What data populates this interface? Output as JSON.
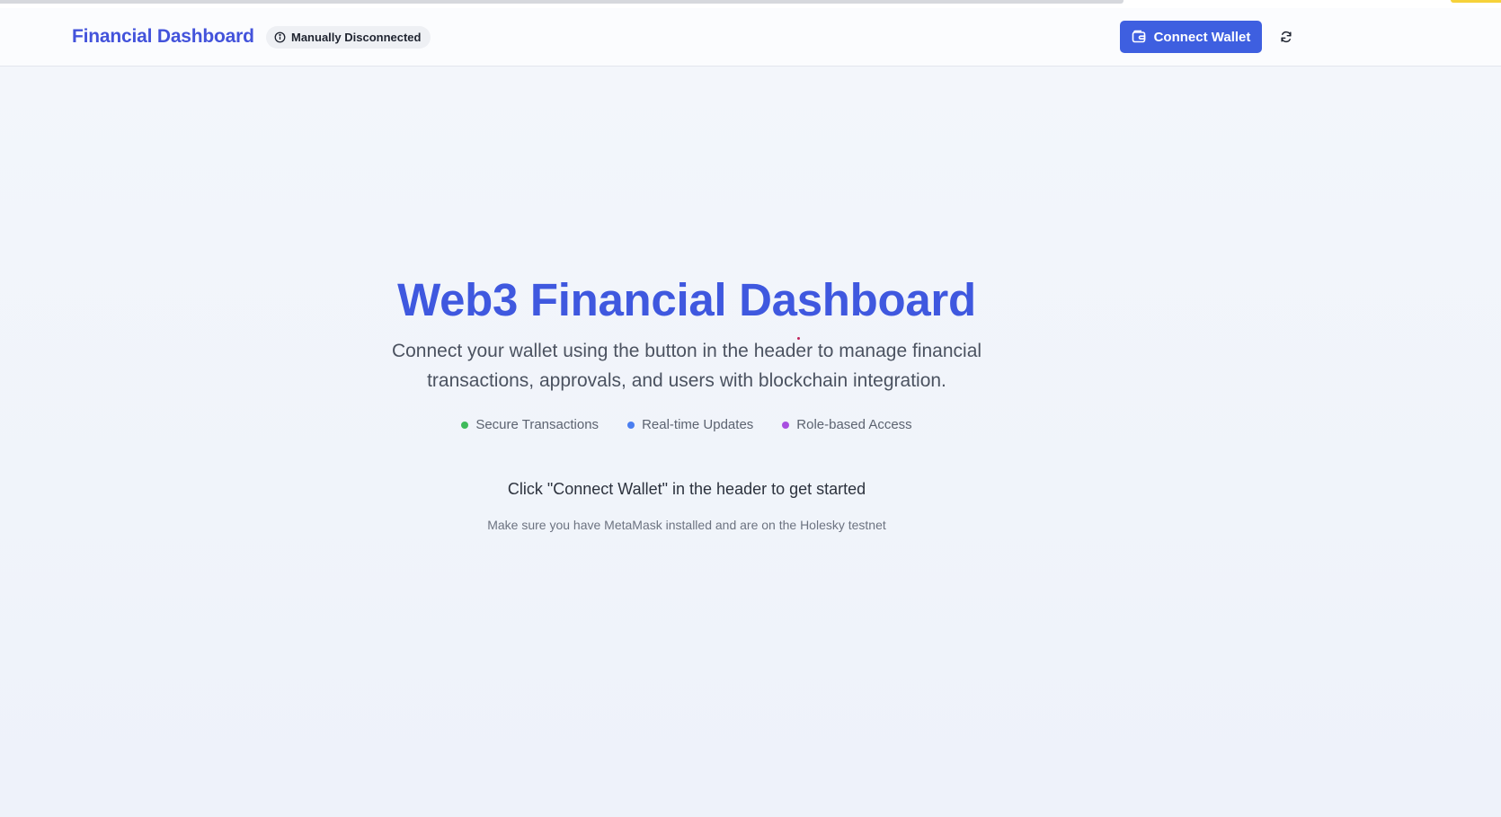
{
  "header": {
    "brand": "Financial Dashboard",
    "status_badge": {
      "label": "Manually Disconnected",
      "icon": "info-circle-icon"
    },
    "connect_button": {
      "label": "Connect Wallet",
      "icon": "wallet-icon"
    },
    "refresh_button": {
      "icon": "refresh-icon"
    }
  },
  "hero": {
    "title": "Web3 Financial Dashboard",
    "description": "Connect your wallet using the button in the header to manage financial transactions, approvals, and users with blockchain integration.",
    "features": [
      {
        "label": "Secure Transactions",
        "color": "#3fba5a"
      },
      {
        "label": "Real-time Updates",
        "color": "#4a7ef0"
      },
      {
        "label": "Role-based Access",
        "color": "#a84fe0"
      }
    ],
    "cta": "Click \"Connect Wallet\" in the header to get started",
    "hint": "Make sure you have MetaMask installed and are on the Holesky testnet"
  },
  "colors": {
    "accent": "#3e5fe0",
    "title": "#3f58df",
    "background": "#eef2f9"
  }
}
